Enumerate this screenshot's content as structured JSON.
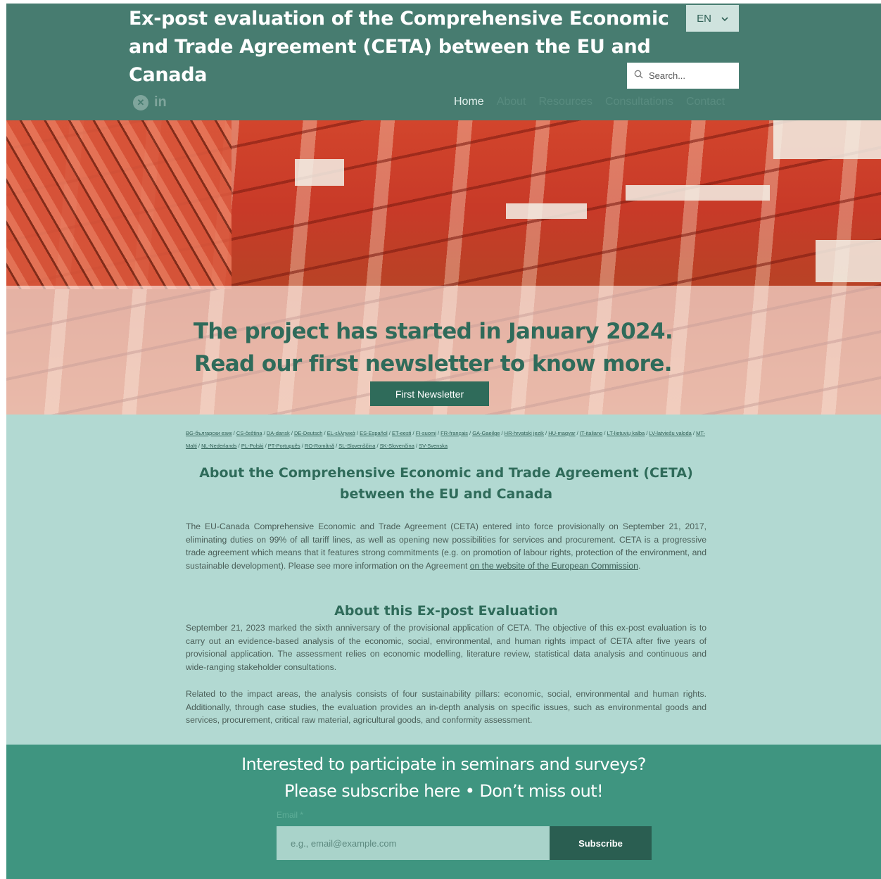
{
  "header": {
    "title_line1": "Ex-post evaluation of the Comprehensive Economic",
    "title_line2": "and Trade Agreement (CETA) between the EU and Canada",
    "lang_selected": "EN",
    "search_placeholder": "Search...",
    "social": {
      "x_icon": "x-icon",
      "linkedin_text": "in"
    },
    "nav": [
      {
        "label": "Home",
        "active": true
      },
      {
        "label": "About"
      },
      {
        "label": "Resources"
      },
      {
        "label": "Consultations"
      },
      {
        "label": "Contact"
      }
    ]
  },
  "hero": {
    "line1": "The project has started in January 2024.",
    "line2": "Read our first newsletter to know more.",
    "button": "First Newsletter"
  },
  "languages": [
    "BG-български език",
    "CS-čeština",
    "DA-dansk",
    "DE-Deutsch",
    "EL-ελληνικά",
    "ES-Español",
    "ET-eesti",
    "FI-suomi",
    "FR-français",
    "GA-Gaeilge",
    "HR-hrvatski jezik",
    "HU-magyar",
    "IT-italiano",
    "LT-lietuvių kalba",
    "LV-latviešu valoda",
    "MT-Malti",
    "NL-Nederlands",
    "PL-Polski",
    "PT-Português",
    "RO-Română",
    "SL-Slovenščina",
    "SK-Slovenčina",
    "SV-Svenska"
  ],
  "about": {
    "heading_line1": "About the Comprehensive Economic and Trade Agreement (CETA)",
    "heading_line2": "between the EU and Canada",
    "paragraph_text": "The EU-Canada Comprehensive Economic and Trade Agreement (CETA) entered into force provisionally on September 21, 2017, eliminating duties on 99% of all tariff lines, as well as opening new possibilities for services and procurement. CETA is a progressive trade agreement which means that it features strong commitments (e.g. on promotion of labour rights, protection of the environment, and sustainable development). Please see more information on the Agreement ",
    "link_text": "on the website of the European Commission",
    "paragraph_end": "."
  },
  "evaluation": {
    "heading": "About this Ex-post Evaluation",
    "paragraph1": "September 21, 2023 marked the sixth anniversary of the provisional application of CETA. The objective of this ex-post evaluation is to carry out an evidence-based analysis of the economic, social, environmental, and human rights impact of CETA after five years of provisional application. The assessment relies on economic modelling, literature review, statistical data analysis and continuous and wide-ranging stakeholder consultations.",
    "paragraph2": "Related to the impact areas, the analysis consists of four sustainability pillars: economic, social, environmental and human rights. Additionally, through case studies, the evaluation provides an in-depth analysis on specific issues, such as environmental goods and services, procurement, critical raw material, agricultural goods, and conformity assessment."
  },
  "footer": {
    "line1": "Interested to participate in seminars and surveys?",
    "line2": "Please subscribe here • Don’t miss out!",
    "email_label": "Email *",
    "email_placeholder": "e.g., email@example.com",
    "subscribe_button": "Subscribe"
  }
}
